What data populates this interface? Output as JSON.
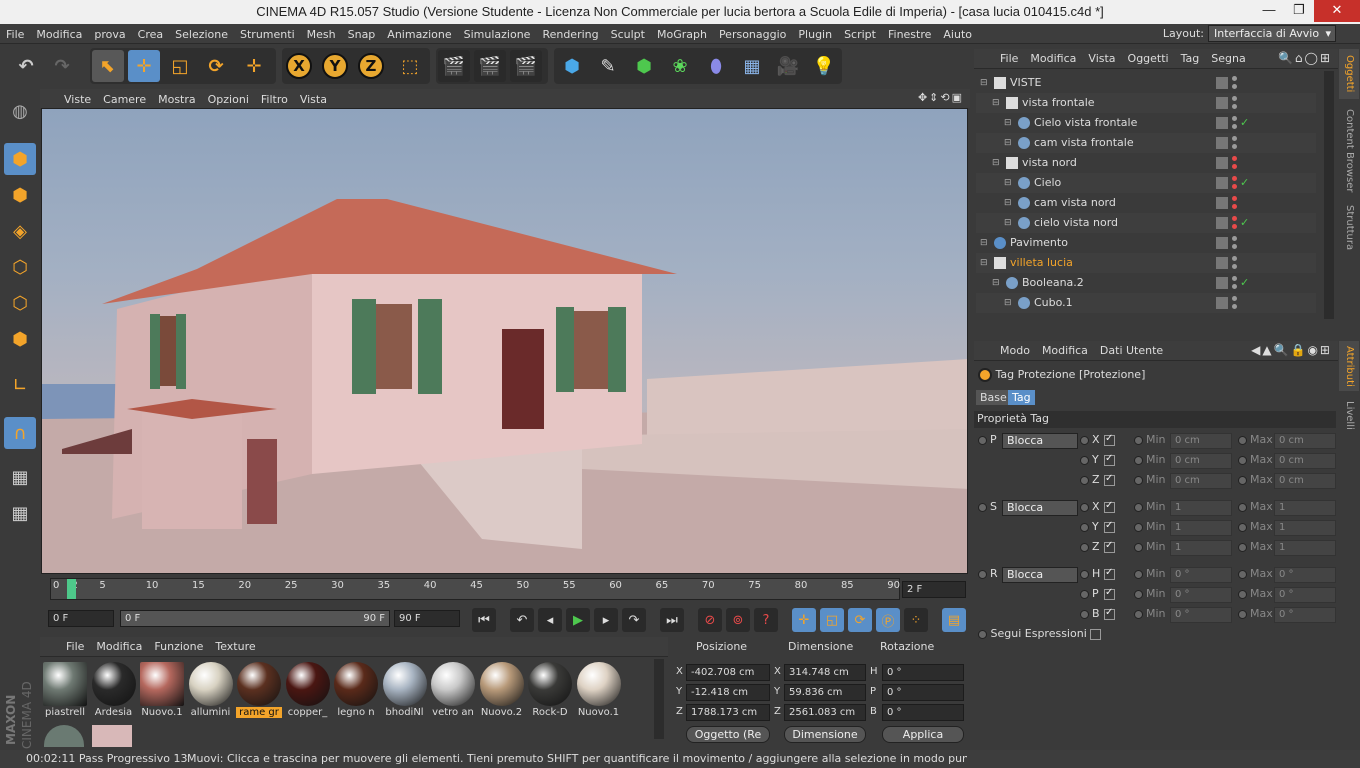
{
  "window": {
    "title": "CINEMA 4D R15.057 Studio (Versione Studente - Licenza Non Commerciale per lucia bertora a Scuola Edile di Imperia) - [casa lucia 010415.c4d *]"
  },
  "menubar": {
    "items": [
      "File",
      "Modifica",
      "prova",
      "Crea",
      "Selezione",
      "Strumenti",
      "Mesh",
      "Snap",
      "Animazione",
      "Simulazione",
      "Rendering",
      "Sculpt",
      "MoGraph",
      "Personaggio",
      "Plugin",
      "Script",
      "Finestre",
      "Aiuto"
    ],
    "layout_label": "Layout:",
    "layout_value": "Interfaccia di Avvio"
  },
  "toolbar": {
    "x": "X",
    "y": "Y",
    "z": "Z"
  },
  "viewport_menu": {
    "items": [
      "Viste",
      "Camere",
      "Mostra",
      "Opzioni",
      "Filtro",
      "Vista"
    ]
  },
  "timeline": {
    "ticks": [
      "0",
      "2",
      "5",
      "10",
      "15",
      "20",
      "25",
      "30",
      "35",
      "40",
      "45",
      "50",
      "55",
      "60",
      "65",
      "70",
      "75",
      "80",
      "85",
      "90"
    ],
    "frame": "2 F"
  },
  "playbar": {
    "start": "0 F",
    "range_start": "0 F",
    "range_end": "90 F",
    "end": "90 F"
  },
  "materials": {
    "menu": [
      "File",
      "Modifica",
      "Funzione",
      "Texture"
    ],
    "items": [
      {
        "name": "piastrell",
        "color": "#6f7a73"
      },
      {
        "name": "Ardesia",
        "color": "#2a2a2a"
      },
      {
        "name": "Nuovo.1",
        "color": "#b5685e"
      },
      {
        "name": "allumini",
        "color": "#d8d2c2"
      },
      {
        "name": "rame gr",
        "color": "#5b3020"
      },
      {
        "name": "copper_",
        "color": "#4a1612"
      },
      {
        "name": "legno n",
        "color": "#5a2a1a"
      },
      {
        "name": "bhodiNl",
        "color": "#a8b4c2"
      },
      {
        "name": "vetro an",
        "color": "#c9c9c9"
      },
      {
        "name": "Nuovo.2",
        "color": "#b89a7a"
      },
      {
        "name": "Rock-D",
        "color": "#3a3a38"
      },
      {
        "name": "Nuovo.1",
        "color": "#ded2c4"
      }
    ]
  },
  "coords": {
    "headers": [
      "Posizione",
      "Dimensione",
      "Rotazione"
    ],
    "rows": [
      {
        "axis": "X",
        "pos": "-402.708 cm",
        "dimaxis": "X",
        "dim": "314.748 cm",
        "rotaxis": "H",
        "rot": "0 °"
      },
      {
        "axis": "Y",
        "pos": "-12.418 cm",
        "dimaxis": "Y",
        "dim": "59.836 cm",
        "rotaxis": "P",
        "rot": "0 °"
      },
      {
        "axis": "Z",
        "pos": "1788.173 cm",
        "dimaxis": "Z",
        "dim": "2561.083 cm",
        "rotaxis": "B",
        "rot": "0 °"
      }
    ],
    "mode": "Oggetto (Re",
    "dimmode": "Dimensione",
    "apply": "Applica"
  },
  "status": {
    "time": "00:02:11 Pass Progressivo 13",
    "message": "Muovi: Clicca e trascina per muovere gli elementi. Tieni premuto SHIFT per quantificare il movimento / aggiungere alla selezione in modo punto, CTRL per"
  },
  "objmgr": {
    "menu": [
      "File",
      "Modifica",
      "Vista",
      "Oggetti",
      "Tag",
      "Segna"
    ],
    "rows": [
      {
        "name": "VISTE",
        "indent": 0
      },
      {
        "name": "vista frontale",
        "indent": 1
      },
      {
        "name": "Cielo vista frontale",
        "indent": 2
      },
      {
        "name": "cam vista frontale",
        "indent": 2
      },
      {
        "name": "vista nord",
        "indent": 1
      },
      {
        "name": "Cielo",
        "indent": 2
      },
      {
        "name": "cam vista nord",
        "indent": 2
      },
      {
        "name": "cielo vista nord",
        "indent": 2
      },
      {
        "name": "Pavimento",
        "indent": 0
      },
      {
        "name": "villeta lucia",
        "indent": 0
      },
      {
        "name": "Booleana.2",
        "indent": 1
      },
      {
        "name": "Cubo.1",
        "indent": 2
      }
    ]
  },
  "attrmgr": {
    "menu": [
      "Modo",
      "Modifica",
      "Dati Utente"
    ],
    "title": "Tag Protezione [Protezione]",
    "tabs": [
      "Base",
      "Tag"
    ],
    "section": "Proprietà Tag",
    "groups": [
      {
        "label": "P",
        "mode": "Blocca",
        "axes": [
          {
            "a": "X",
            "min": "0 cm",
            "max": "0 cm"
          },
          {
            "a": "Y",
            "min": "0 cm",
            "max": "0 cm"
          },
          {
            "a": "Z",
            "min": "0 cm",
            "max": "0 cm"
          }
        ]
      },
      {
        "label": "S",
        "mode": "Blocca",
        "axes": [
          {
            "a": "X",
            "min": "1",
            "max": "1"
          },
          {
            "a": "Y",
            "min": "1",
            "max": "1"
          },
          {
            "a": "Z",
            "min": "1",
            "max": "1"
          }
        ]
      },
      {
        "label": "R",
        "mode": "Blocca",
        "axes": [
          {
            "a": "H",
            "min": "0 °",
            "max": "0 °"
          },
          {
            "a": "P",
            "min": "0 °",
            "max": "0 °"
          },
          {
            "a": "B",
            "min": "0 °",
            "max": "0 °"
          }
        ]
      }
    ],
    "minlabel": "Min",
    "maxlabel": "Max",
    "follow": "Segui Espressioni"
  },
  "sidetabs": [
    "Oggetti",
    "Content Browser",
    "Struttura",
    "Attributi",
    "Livelli"
  ],
  "brand": {
    "maxon": "MAXON",
    "cinema": "CINEMA 4D"
  }
}
